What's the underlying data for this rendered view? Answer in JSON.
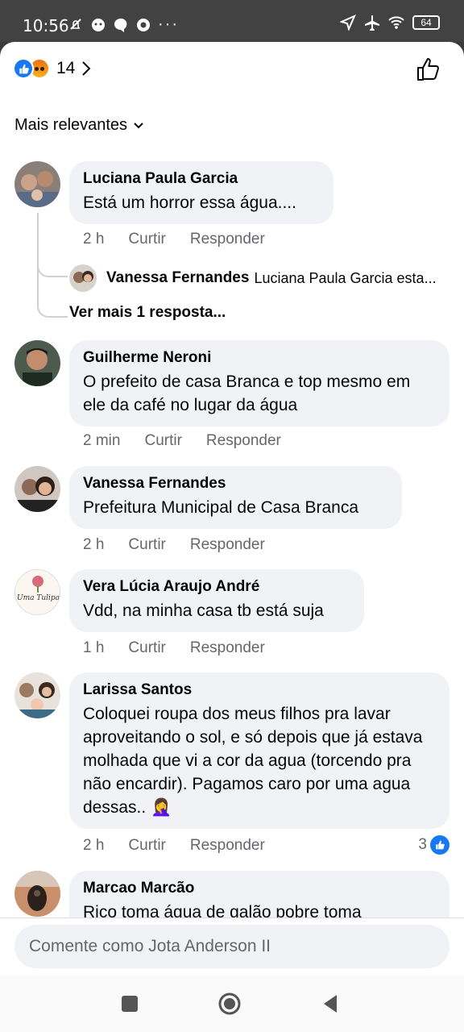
{
  "status_bar": {
    "time": "10:56",
    "battery": "64"
  },
  "header": {
    "reaction_count": "14"
  },
  "sort": {
    "label": "Mais relevantes"
  },
  "comments": [
    {
      "name": "Luciana Paula Garcia",
      "text": "Está um horror essa água....",
      "time": "2 h",
      "like_label": "Curtir",
      "reply_label": "Responder"
    },
    {
      "name": "Guilherme Neroni",
      "text": "O prefeito de casa Branca e top mesmo em ele da café no lugar da água",
      "time": "2 min",
      "like_label": "Curtir",
      "reply_label": "Responder"
    },
    {
      "name": "Vanessa Fernandes",
      "text": "Prefeitura Municipal de Casa Branca",
      "time": "2 h",
      "like_label": "Curtir",
      "reply_label": "Responder"
    },
    {
      "name": "Vera Lúcia Araujo André",
      "text": "Vdd, na minha casa tb está suja",
      "time": "1 h",
      "like_label": "Curtir",
      "reply_label": "Responder",
      "avatar_text": "Uma Tulipa"
    },
    {
      "name": "Larissa Santos",
      "text": "Coloquei roupa dos meus filhos pra lavar aproveitando o sol, e só depois que já estava molhada que vi a cor da agua (torcendo pra não encardir). Pagamos caro por uma agua dessas.. 🤦‍♀️",
      "time": "2 h",
      "like_label": "Curtir",
      "reply_label": "Responder",
      "reactions": "3"
    },
    {
      "name": "Marcao Marcão",
      "text": "Rico toma água de galão pobre toma"
    }
  ],
  "reply": {
    "name": "Vanessa Fernandes",
    "text": "Luciana Paula Garcia esta...",
    "see_more": "Ver mais 1 resposta..."
  },
  "composer": {
    "placeholder": "Comente como Jota Anderson II"
  },
  "colors": {
    "accent": "#1877f2",
    "bubble": "#f0f2f5",
    "secondary_text": "#65676b"
  }
}
